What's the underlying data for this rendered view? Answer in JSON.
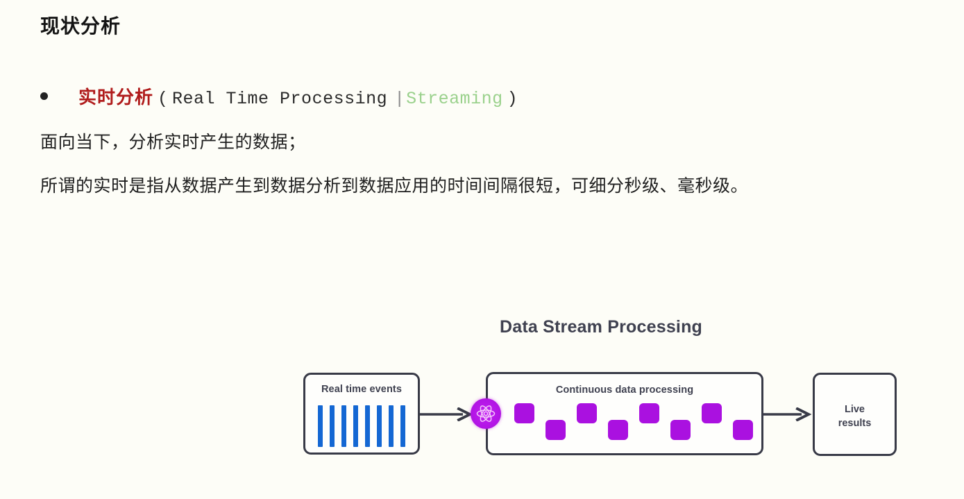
{
  "slide": {
    "title": "现状分析",
    "background_color": "#fdfdf7"
  },
  "bullet": {
    "marker": "bullet-dot",
    "term_cn": "实时分析",
    "term_cn_color": "#b01b1b",
    "paren_open": "(",
    "term_en": "Real Time Processing",
    "pipe": "|",
    "term_en_alt": "Streaming",
    "term_en_alt_color": "#9ad18c",
    "paren_close": ")"
  },
  "body": {
    "line1": "面向当下，分析实时产生的数据；",
    "line2": "所谓的实时是指从数据产生到数据分析到数据应用的时间间隔很短，可细分秒级、毫秒级。"
  },
  "diagram": {
    "title": "Data Stream Processing",
    "title_color": "#3f4150",
    "stroke_color": "#383a47",
    "stages": [
      {
        "id": "events",
        "label": "Real time events",
        "bar_count": 8,
        "bar_color": "#1467d3"
      },
      {
        "id": "processing",
        "label": "Continuous data processing",
        "square_count": 8,
        "square_color": "#aa11e0",
        "node_icon": "atom-icon",
        "node_color": "#b316e6"
      },
      {
        "id": "results",
        "label": "Live\nresults",
        "label_line1": "Live",
        "label_line2": "results"
      }
    ],
    "connectors": [
      {
        "id": "arrow-1",
        "from": "events",
        "to": "processing"
      },
      {
        "id": "arrow-2",
        "from": "processing",
        "to": "results"
      }
    ]
  }
}
